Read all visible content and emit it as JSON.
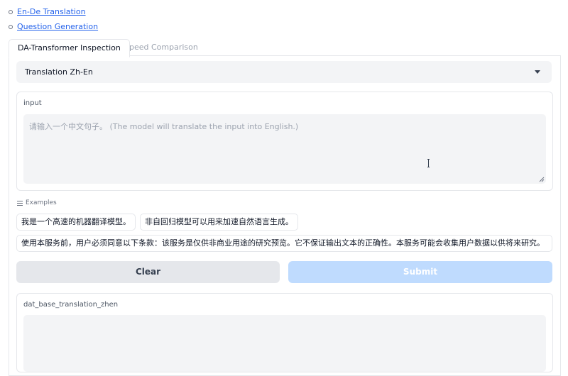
{
  "links": [
    {
      "label": "En-De Translation"
    },
    {
      "label": "Question Generation"
    }
  ],
  "tabs": [
    {
      "label": "DA-Transformer Inspection",
      "active": true
    },
    {
      "label": "Speed Comparison",
      "active": false
    }
  ],
  "dropdown": {
    "selected": "Translation Zh-En"
  },
  "input": {
    "label": "input",
    "placeholder": "请输入一个中文句子。 (The model will translate the input into English.)",
    "value": ""
  },
  "examples": {
    "header": "Examples",
    "items": [
      "我是一个高速的机器翻译模型。",
      "非自回归模型可以用来加速自然语言生成。",
      "使用本服务前，用户必须同意以下条款：该服务是仅供非商业用途的研究预览。它不保证输出文本的正确性。本服务可能会收集用户数据以供将来研究。"
    ]
  },
  "buttons": {
    "clear": "Clear",
    "submit": "Submit"
  },
  "output": {
    "label": "dat_base_translation_zhen"
  },
  "colors": {
    "link": "#2563eb",
    "submit_bg": "#bfdbfe",
    "field_bg": "#f3f4f6",
    "border": "#e5e7eb"
  }
}
